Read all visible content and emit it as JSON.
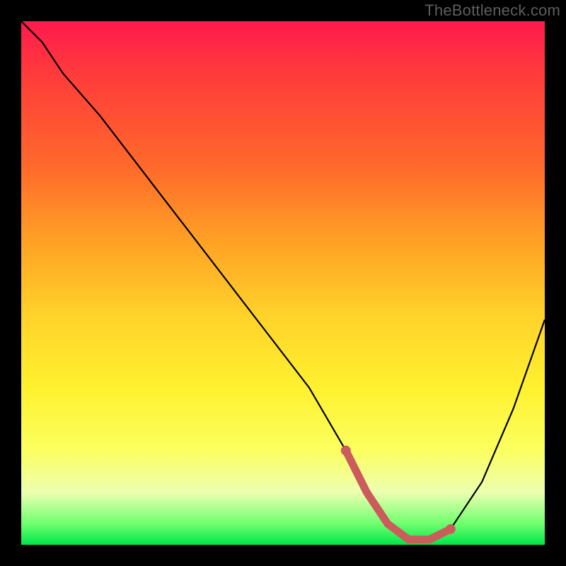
{
  "watermark": "TheBottleneck.com",
  "colors": {
    "background": "#000000",
    "curve": "#000000",
    "highlight": "#cc5b5b"
  },
  "chart_data": {
    "type": "line",
    "title": "",
    "xlabel": "",
    "ylabel": "",
    "xlim": [
      0,
      100
    ],
    "ylim": [
      0,
      100
    ],
    "x": [
      0,
      4,
      8,
      15,
      25,
      35,
      45,
      55,
      62,
      66,
      70,
      74,
      78,
      82,
      88,
      94,
      100
    ],
    "values": [
      100,
      96,
      90,
      82,
      69,
      56,
      43,
      30,
      18,
      10,
      4,
      1,
      1,
      3,
      12,
      26,
      43
    ],
    "highlight_range_x": [
      62,
      84
    ]
  }
}
